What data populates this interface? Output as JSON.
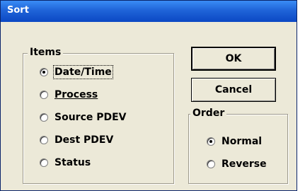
{
  "window": {
    "title": "Sort"
  },
  "items_group": {
    "legend": "Items",
    "options": [
      {
        "label": "Date/Time",
        "checked": true
      },
      {
        "label": "Process",
        "checked": false
      },
      {
        "label": "Source PDEV",
        "checked": false
      },
      {
        "label": "Dest PDEV",
        "checked": false
      },
      {
        "label": "Status",
        "checked": false
      }
    ]
  },
  "buttons": {
    "ok": "OK",
    "cancel": "Cancel"
  },
  "order_group": {
    "legend": "Order",
    "options": [
      {
        "label": "Normal",
        "checked": true
      },
      {
        "label": "Reverse",
        "checked": false
      }
    ]
  }
}
